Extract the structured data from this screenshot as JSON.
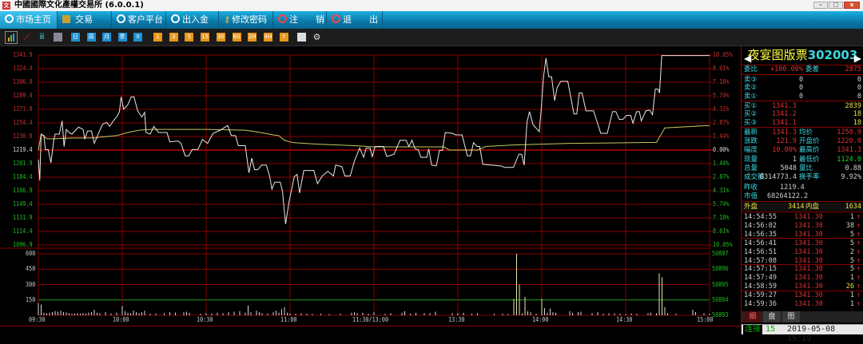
{
  "window": {
    "title": "中國國際文化產權交易所 (6.0.0.1)",
    "logo": "文",
    "min": "–",
    "max": "□",
    "close": "x"
  },
  "menu": [
    {
      "label": "市场主页",
      "icon": "refresh-icon",
      "active": true
    },
    {
      "label": "交易",
      "icon": "trade-icon"
    },
    {
      "label": "客户平台",
      "icon": "refresh-icon"
    },
    {
      "label": "出入金",
      "icon": "refresh-icon"
    },
    {
      "label": "修改密码",
      "icon": "key-icon"
    },
    {
      "label": "注　　销",
      "icon": "power-icon"
    },
    {
      "label": "退　　出",
      "icon": "power-icon"
    }
  ],
  "toolbar": {
    "blue": [
      "日",
      "周",
      "月",
      "季",
      "X"
    ],
    "orange": [
      "1",
      "3",
      "5",
      "15",
      "30",
      "60",
      "2H",
      "4H",
      "Y"
    ]
  },
  "stock": {
    "name": "夜宴图版票",
    "code": "302003"
  },
  "quote": {
    "weibi_label": "委比",
    "weibi": "+100.00%",
    "weicha_label": "委差",
    "weicha": "2875",
    "asks": [
      {
        "label": "卖③",
        "price": "0",
        "vol": "0"
      },
      {
        "label": "卖②",
        "price": "0",
        "vol": "0"
      },
      {
        "label": "卖①",
        "price": "0",
        "vol": "0"
      }
    ],
    "bids": [
      {
        "label": "买①",
        "price": "1341.3",
        "vol": "2839"
      },
      {
        "label": "买②",
        "price": "1341.2",
        "vol": "18"
      },
      {
        "label": "买③",
        "price": "1341.1",
        "vol": "18"
      }
    ],
    "stats": [
      {
        "l1": "最新",
        "v1": "1341.3",
        "l2": "均价",
        "v2": "1250.9"
      },
      {
        "l1": "涨跌",
        "v1": "121.9",
        "l2": "开盘价",
        "v2": "1220.0"
      },
      {
        "l1": "幅度",
        "v1": "10.00%",
        "l2": "最高价",
        "v2": "1341.3"
      },
      {
        "l1": "现量",
        "v1": "1",
        "l2": "最低价",
        "v2": "1124.0"
      },
      {
        "l1": "总量",
        "v1": "5048",
        "l2": "量比",
        "v2": "0.88"
      },
      {
        "l1": "成交额",
        "v1": "6314773.4",
        "l2": "换手率",
        "v2": "9.92%"
      }
    ],
    "prev_close_label": "昨收",
    "prev_close": "1219.4",
    "mktcap_label": "市值",
    "mktcap": "68264122.2",
    "outer_label": "外盘",
    "outer": "3414",
    "inner_label": "内盘",
    "inner": "1634"
  },
  "trades": [
    {
      "t": "14:54:55",
      "p": "1341.30",
      "v": "1"
    },
    {
      "t": "14:56:02",
      "p": "1341.30",
      "v": "38"
    },
    {
      "t": "14:56:35",
      "p": "1341.30",
      "v": "5"
    },
    {
      "t": "14:56:41",
      "p": "1341.30",
      "v": "5"
    },
    {
      "t": "14:56:51",
      "p": "1341.30",
      "v": "2"
    },
    {
      "t": "14:57:08",
      "p": "1341.30",
      "v": "5"
    },
    {
      "t": "14:57:15",
      "p": "1341.30",
      "v": "5"
    },
    {
      "t": "14:57:49",
      "p": "1341.30",
      "v": "1"
    },
    {
      "t": "14:58:59",
      "p": "1341.30",
      "v": "26"
    },
    {
      "t": "14:59:27",
      "p": "1341.30",
      "v": "1"
    },
    {
      "t": "14:59:36",
      "p": "1341.30",
      "v": "1"
    }
  ],
  "tabs": [
    "细",
    "盘",
    "图"
  ],
  "status": {
    "conn_label": "连接",
    "conn": "15",
    "datetime": "2019-05-08 15:19"
  },
  "chart_data": {
    "type": "line",
    "prev_close": 1219.4,
    "ylim": [
      1096.9,
      1341.9
    ],
    "price_ticks": [
      "1341.9",
      "1324.4",
      "1306.9",
      "1289.4",
      "1271.9",
      "1254.4",
      "1236.9",
      "1219.4",
      "1201.9",
      "1184.4",
      "1166.9",
      "1149.4",
      "1131.9",
      "1114.4",
      "1096.9"
    ],
    "pct_ticks": [
      "10.05%",
      "8.61%",
      "7.18%",
      "5.74%",
      "4.31%",
      "2.87%",
      "1.44%",
      "0.00%",
      "1.44%",
      "2.87%",
      "4.31%",
      "5.74%",
      "7.18%",
      "8.61%",
      "10.05%"
    ],
    "time_ticks": [
      "09:30",
      "10:00",
      "10:30",
      "11:00",
      "11:30/13:00",
      "13:30",
      "14:00",
      "14:30",
      "15:00"
    ],
    "vol_ticks": [
      "600",
      "450",
      "300",
      "150"
    ],
    "vol_right_ticks": [
      "50897",
      "50896",
      "50895",
      "50894",
      "50893"
    ],
    "vol_ylim": [
      0,
      600
    ],
    "x_minutes": 240,
    "price": [
      [
        0,
        1207
      ],
      [
        0.5,
        1180
      ],
      [
        1,
        1240
      ],
      [
        2,
        1238
      ],
      [
        2.5,
        1220
      ],
      [
        3.5,
        1220
      ],
      [
        4.5,
        1203
      ],
      [
        5.5,
        1232
      ],
      [
        6,
        1240
      ],
      [
        7.5,
        1240
      ],
      [
        8.5,
        1257
      ],
      [
        9.2,
        1224
      ],
      [
        10,
        1246
      ],
      [
        11,
        1242
      ],
      [
        12,
        1240
      ],
      [
        14.4,
        1249
      ],
      [
        16,
        1246
      ],
      [
        16.6,
        1234
      ],
      [
        17.6,
        1244
      ],
      [
        19,
        1244
      ],
      [
        20,
        1228
      ],
      [
        21.5,
        1241
      ],
      [
        23,
        1253
      ],
      [
        24.5,
        1255
      ],
      [
        25.5,
        1250
      ],
      [
        27,
        1258
      ],
      [
        28,
        1262
      ],
      [
        29,
        1269
      ],
      [
        29.6,
        1288
      ],
      [
        30.5,
        1272
      ],
      [
        32,
        1278
      ],
      [
        33.2,
        1288
      ],
      [
        34.2,
        1288
      ],
      [
        35.5,
        1270
      ],
      [
        37,
        1262
      ],
      [
        38,
        1268
      ],
      [
        38.5,
        1242
      ],
      [
        40,
        1240
      ],
      [
        41.3,
        1250
      ],
      [
        43,
        1242
      ],
      [
        46,
        1242
      ],
      [
        47,
        1230
      ],
      [
        50,
        1231
      ],
      [
        51,
        1228
      ],
      [
        52.5,
        1212
      ],
      [
        53.8,
        1212
      ],
      [
        55,
        1220
      ],
      [
        57,
        1220
      ],
      [
        58.7,
        1233
      ],
      [
        60.5,
        1228
      ],
      [
        62.5,
        1241
      ],
      [
        65,
        1245
      ],
      [
        67.7,
        1251
      ],
      [
        69,
        1238
      ],
      [
        70.5,
        1238
      ],
      [
        71.5,
        1225
      ],
      [
        74,
        1225
      ],
      [
        75.3,
        1190
      ],
      [
        76.3,
        1209
      ],
      [
        77.3,
        1194
      ],
      [
        78.5,
        1194
      ],
      [
        79.8,
        1200
      ],
      [
        81.5,
        1200
      ],
      [
        82.7,
        1186
      ],
      [
        83.5,
        1169
      ],
      [
        84.5,
        1178
      ],
      [
        86.5,
        1178
      ],
      [
        87.3,
        1166
      ],
      [
        88.4,
        1124
      ],
      [
        89.6,
        1152
      ],
      [
        91.5,
        1185
      ],
      [
        92.5,
        1188
      ],
      [
        93.4,
        1164
      ],
      [
        94.9,
        1193
      ],
      [
        98.5,
        1193
      ],
      [
        99.8,
        1176
      ],
      [
        101.5,
        1186
      ],
      [
        103.5,
        1192
      ],
      [
        105.5,
        1186
      ],
      [
        106.3,
        1200
      ],
      [
        108.5,
        1198
      ],
      [
        109.6,
        1186
      ],
      [
        111.5,
        1186
      ],
      [
        113,
        1205
      ],
      [
        114.9,
        1222
      ],
      [
        116.3,
        1210
      ],
      [
        117.2,
        1222
      ],
      [
        118.6,
        1222
      ],
      [
        119.4,
        1211
      ],
      [
        120.4,
        1224
      ],
      [
        123.4,
        1224
      ],
      [
        124.6,
        1211
      ],
      [
        127.2,
        1214
      ],
      [
        129.3,
        1232
      ],
      [
        131.5,
        1232
      ],
      [
        132.5,
        1224
      ],
      [
        133.6,
        1232
      ],
      [
        134.7,
        1221
      ],
      [
        135.8,
        1220
      ],
      [
        136.8,
        1210
      ],
      [
        138.9,
        1210
      ],
      [
        139.6,
        1221
      ],
      [
        140.6,
        1200
      ],
      [
        142.3,
        1199
      ],
      [
        143.4,
        1219
      ],
      [
        144.5,
        1219
      ],
      [
        145.5,
        1242
      ],
      [
        148,
        1241
      ],
      [
        149.2,
        1239
      ],
      [
        151.5,
        1239
      ],
      [
        153.4,
        1212
      ],
      [
        154.5,
        1212
      ],
      [
        155.6,
        1229
      ],
      [
        156.8,
        1224
      ],
      [
        157.8,
        1224
      ],
      [
        158.9,
        1201
      ],
      [
        165.3,
        1199
      ],
      [
        166.8,
        1197
      ],
      [
        169.9,
        1197
      ],
      [
        171.8,
        1214
      ],
      [
        172.8,
        1214
      ],
      [
        173.7,
        1200
      ],
      [
        174.7,
        1255
      ],
      [
        175.6,
        1269
      ],
      [
        176.9,
        1252
      ],
      [
        177.9,
        1248
      ],
      [
        179.1,
        1243
      ],
      [
        179.8,
        1272
      ],
      [
        180.6,
        1313
      ],
      [
        181.5,
        1338
      ],
      [
        182.5,
        1314
      ],
      [
        183.5,
        1314
      ],
      [
        184.6,
        1283
      ],
      [
        185.5,
        1300
      ],
      [
        186.8,
        1308
      ],
      [
        189.3,
        1308
      ],
      [
        191.5,
        1266
      ],
      [
        192.5,
        1266
      ],
      [
        193.4,
        1293
      ],
      [
        194.4,
        1293
      ],
      [
        195.8,
        1270
      ],
      [
        198.5,
        1270
      ],
      [
        201.1,
        1241
      ],
      [
        203.4,
        1241
      ],
      [
        205.3,
        1269
      ],
      [
        206.5,
        1269
      ],
      [
        207.7,
        1259
      ],
      [
        209,
        1259
      ],
      [
        210.3,
        1264
      ],
      [
        211.8,
        1264
      ],
      [
        212.6,
        1254
      ],
      [
        213.9,
        1269
      ],
      [
        214.9,
        1269
      ],
      [
        215.6,
        1257
      ],
      [
        217.2,
        1270
      ],
      [
        218.6,
        1271
      ],
      [
        219.6,
        1265
      ],
      [
        220.6,
        1298
      ],
      [
        221.6,
        1298
      ],
      [
        222.1,
        1293
      ],
      [
        222.9,
        1341.3
      ],
      [
        240,
        1341.3
      ]
    ],
    "avg": [
      [
        0,
        1219
      ],
      [
        1,
        1240
      ],
      [
        3,
        1234
      ],
      [
        6,
        1234
      ],
      [
        12,
        1235
      ],
      [
        20,
        1235
      ],
      [
        22,
        1236
      ],
      [
        28,
        1238
      ],
      [
        32,
        1242
      ],
      [
        36,
        1245
      ],
      [
        40,
        1246
      ],
      [
        60,
        1246
      ],
      [
        74,
        1245
      ],
      [
        78,
        1243
      ],
      [
        84,
        1239
      ],
      [
        86,
        1238
      ],
      [
        88,
        1232
      ],
      [
        91,
        1229
      ],
      [
        100,
        1227
      ],
      [
        113,
        1225
      ],
      [
        120,
        1223.5
      ],
      [
        145,
        1223.5
      ],
      [
        147,
        1219.4
      ],
      [
        157,
        1219.4
      ],
      [
        160,
        1224
      ],
      [
        170,
        1226
      ],
      [
        190,
        1228
      ],
      [
        215,
        1229
      ],
      [
        221,
        1229.3
      ],
      [
        224,
        1248
      ],
      [
        240,
        1251
      ]
    ],
    "volume": [
      [
        0,
        120
      ],
      [
        1,
        105
      ],
      [
        2,
        25
      ],
      [
        3,
        20
      ],
      [
        4,
        25
      ],
      [
        5,
        30
      ],
      [
        6,
        40
      ],
      [
        7,
        35
      ],
      [
        8,
        45
      ],
      [
        9,
        30
      ],
      [
        10,
        28
      ],
      [
        11,
        20
      ],
      [
        12,
        15
      ],
      [
        13,
        18
      ],
      [
        14,
        20
      ],
      [
        15,
        15
      ],
      [
        16,
        22
      ],
      [
        17,
        18
      ],
      [
        18,
        25
      ],
      [
        19,
        30
      ],
      [
        20,
        55
      ],
      [
        21,
        25
      ],
      [
        22,
        20
      ],
      [
        24,
        30
      ],
      [
        26,
        18
      ],
      [
        28,
        25
      ],
      [
        30,
        90
      ],
      [
        31,
        40
      ],
      [
        32,
        25
      ],
      [
        33,
        20
      ],
      [
        34,
        45
      ],
      [
        35,
        30
      ],
      [
        36,
        20
      ],
      [
        37,
        30
      ],
      [
        38,
        45
      ],
      [
        40,
        15
      ],
      [
        42,
        18
      ],
      [
        45,
        20
      ],
      [
        47,
        30
      ],
      [
        49,
        25
      ],
      [
        52,
        30
      ],
      [
        53,
        35
      ],
      [
        54,
        25
      ],
      [
        58,
        15
      ],
      [
        60,
        20
      ],
      [
        62,
        18
      ],
      [
        64,
        25
      ],
      [
        66,
        20
      ],
      [
        68,
        30
      ],
      [
        70,
        35
      ],
      [
        72,
        40
      ],
      [
        74,
        25
      ],
      [
        75,
        95
      ],
      [
        76,
        30
      ],
      [
        78,
        45
      ],
      [
        79,
        30
      ],
      [
        80,
        20
      ],
      [
        82,
        18
      ],
      [
        84,
        30
      ],
      [
        85,
        45
      ],
      [
        86,
        25
      ],
      [
        87,
        60
      ],
      [
        88,
        80
      ],
      [
        89,
        25
      ],
      [
        90,
        18
      ],
      [
        92,
        15
      ],
      [
        94,
        20
      ],
      [
        96,
        15
      ],
      [
        98,
        12
      ],
      [
        101,
        15
      ],
      [
        104,
        12
      ],
      [
        108,
        15
      ],
      [
        112,
        25
      ],
      [
        113,
        30
      ],
      [
        114,
        20
      ],
      [
        116,
        25
      ],
      [
        118,
        15
      ],
      [
        120,
        30
      ],
      [
        124,
        15
      ],
      [
        126,
        20
      ],
      [
        130,
        25
      ],
      [
        131,
        40
      ],
      [
        133,
        15
      ],
      [
        135,
        25
      ],
      [
        138,
        20
      ],
      [
        140,
        20
      ],
      [
        142,
        35
      ],
      [
        148,
        20
      ],
      [
        150,
        20
      ],
      [
        152,
        25
      ],
      [
        155,
        15
      ],
      [
        157,
        20
      ],
      [
        163,
        15
      ],
      [
        166,
        15
      ],
      [
        168,
        12
      ],
      [
        170,
        160
      ],
      [
        171,
        600
      ],
      [
        172,
        300
      ],
      [
        173,
        20
      ],
      [
        174,
        180
      ],
      [
        175,
        40
      ],
      [
        176,
        30
      ],
      [
        178,
        15
      ],
      [
        180,
        160
      ],
      [
        181,
        70
      ],
      [
        182,
        25
      ],
      [
        183,
        65
      ],
      [
        184,
        30
      ],
      [
        185,
        25
      ],
      [
        190,
        40
      ],
      [
        191,
        25
      ],
      [
        193,
        30
      ],
      [
        194,
        35
      ],
      [
        198,
        20
      ],
      [
        200,
        30
      ],
      [
        202,
        15
      ],
      [
        204,
        20
      ],
      [
        206,
        18
      ],
      [
        208,
        15
      ],
      [
        210,
        12
      ],
      [
        212,
        18
      ],
      [
        214,
        15
      ],
      [
        218,
        20
      ],
      [
        219,
        25
      ],
      [
        221,
        20
      ],
      [
        222,
        410
      ],
      [
        223,
        370
      ],
      [
        224,
        80
      ],
      [
        225,
        20
      ],
      [
        228,
        15
      ],
      [
        234,
        55
      ],
      [
        235,
        30
      ],
      [
        238,
        20
      ],
      [
        240,
        15
      ]
    ]
  }
}
